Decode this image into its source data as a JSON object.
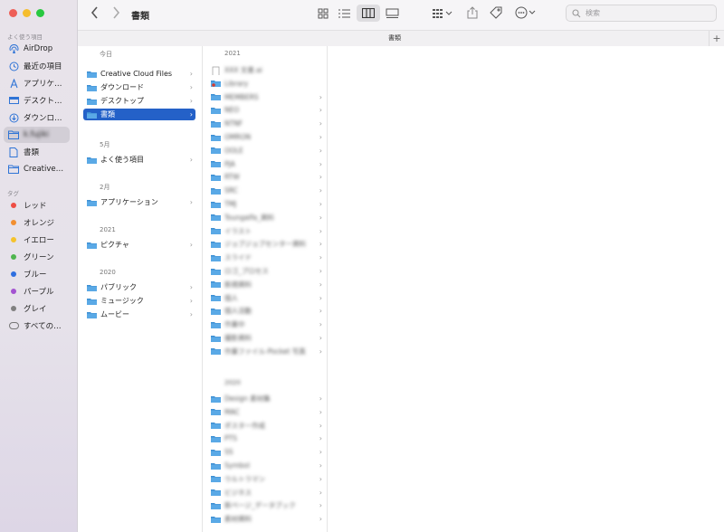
{
  "window": {
    "title": "書類"
  },
  "colors": {
    "accent": "#2461c8",
    "folder": "#5aa9e6",
    "folder_dark": "#3d8fd3"
  },
  "search": {
    "placeholder": "検索"
  },
  "sidebar": {
    "favorites_label": "よく使う項目",
    "favorites": [
      {
        "label": "AirDrop",
        "icon": "airdrop-icon"
      },
      {
        "label": "最近の項目",
        "icon": "clock-icon"
      },
      {
        "label": "アプリケ…",
        "icon": "applications-icon"
      },
      {
        "label": "デスクト…",
        "icon": "desktop-icon"
      },
      {
        "label": "ダウンロ…",
        "icon": "download-icon"
      },
      {
        "label": "k.fujiki",
        "icon": "home-folder-icon"
      },
      {
        "label": "書類",
        "icon": "document-icon"
      },
      {
        "label": "Creative…",
        "icon": "folder-icon"
      }
    ],
    "tags_label": "タグ",
    "tags": [
      {
        "label": "レッド",
        "color": "#ee4d44"
      },
      {
        "label": "オレンジ",
        "color": "#f28f30"
      },
      {
        "label": "イエロー",
        "color": "#f5c32c"
      },
      {
        "label": "グリーン",
        "color": "#4fb54f"
      },
      {
        "label": "ブルー",
        "color": "#2f6fe0"
      },
      {
        "label": "パープル",
        "color": "#a353d1"
      },
      {
        "label": "グレイ",
        "color": "#808080"
      },
      {
        "label": "すべての…",
        "color": ""
      }
    ]
  },
  "column1": {
    "groups": [
      {
        "label": "今日",
        "items": [
          {
            "name": "Creative Cloud Files",
            "selected": false
          },
          {
            "name": "ダウンロード",
            "selected": false
          },
          {
            "name": "デスクトップ",
            "selected": false
          },
          {
            "name": "書類",
            "selected": true
          }
        ]
      },
      {
        "label": "5月",
        "items": [
          {
            "name": "よく使う項目",
            "selected": false
          }
        ]
      },
      {
        "label": "2月",
        "items": [
          {
            "name": "アプリケーション",
            "selected": false
          }
        ]
      },
      {
        "label": "2021",
        "items": [
          {
            "name": "ピクチャ",
            "selected": false
          }
        ]
      },
      {
        "label": "2020",
        "items": [
          {
            "name": "パブリック",
            "selected": false
          },
          {
            "name": "ミュージック",
            "selected": false
          },
          {
            "name": "ムービー",
            "selected": false
          }
        ]
      }
    ]
  },
  "column2": {
    "group1_label": "2021",
    "group1": [
      {
        "name": "XXX 文書.ai",
        "type": "file",
        "chev": false
      },
      {
        "name": "Library",
        "type": "folder-red",
        "chev": false
      },
      {
        "name": "MEMBERS",
        "type": "folder",
        "chev": true
      },
      {
        "name": "NEO",
        "type": "folder",
        "chev": true
      },
      {
        "name": "NTNF",
        "type": "folder",
        "chev": true
      },
      {
        "name": "OMRON",
        "type": "folder",
        "chev": true
      },
      {
        "name": "OOLE",
        "type": "folder",
        "chev": true
      },
      {
        "name": "PJA",
        "type": "folder",
        "chev": true
      },
      {
        "name": "RTW",
        "type": "folder",
        "chev": true
      },
      {
        "name": "SRC",
        "type": "folder",
        "chev": true
      },
      {
        "name": "TMJ",
        "type": "folder",
        "chev": true
      },
      {
        "name": "Toungalfa_資料",
        "type": "folder",
        "chev": true
      },
      {
        "name": "イラスト",
        "type": "folder",
        "chev": true
      },
      {
        "name": "ジョブジョブセンター資料",
        "type": "folder",
        "chev": true
      },
      {
        "name": "スライド",
        "type": "folder",
        "chev": true
      },
      {
        "name": "ロゴ_プロセス",
        "type": "folder",
        "chev": true
      },
      {
        "name": "新規資料",
        "type": "folder",
        "chev": true
      },
      {
        "name": "個人",
        "type": "folder",
        "chev": true
      },
      {
        "name": "個人活動",
        "type": "folder",
        "chev": true
      },
      {
        "name": "作業中",
        "type": "folder",
        "chev": true
      },
      {
        "name": "撮影資料",
        "type": "folder",
        "chev": true
      },
      {
        "name": "作業ファイル-Pocket 写真",
        "type": "folder",
        "chev": true
      }
    ],
    "group2_label": "2020",
    "group2": [
      {
        "name": "Design 素材集",
        "type": "folder",
        "chev": true
      },
      {
        "name": "MAC",
        "type": "folder",
        "chev": true
      },
      {
        "name": "ポスター作成",
        "type": "folder",
        "chev": true
      },
      {
        "name": "PTS",
        "type": "folder",
        "chev": true
      },
      {
        "name": "SS",
        "type": "folder",
        "chev": true
      },
      {
        "name": "Symbol",
        "type": "folder",
        "chev": true
      },
      {
        "name": "ウルトラマン",
        "type": "folder",
        "chev": true
      },
      {
        "name": "ビジネス",
        "type": "folder",
        "chev": true
      },
      {
        "name": "新ページ_データブック",
        "type": "folder",
        "chev": true
      },
      {
        "name": "素材資料",
        "type": "folder",
        "chev": true
      }
    ]
  }
}
